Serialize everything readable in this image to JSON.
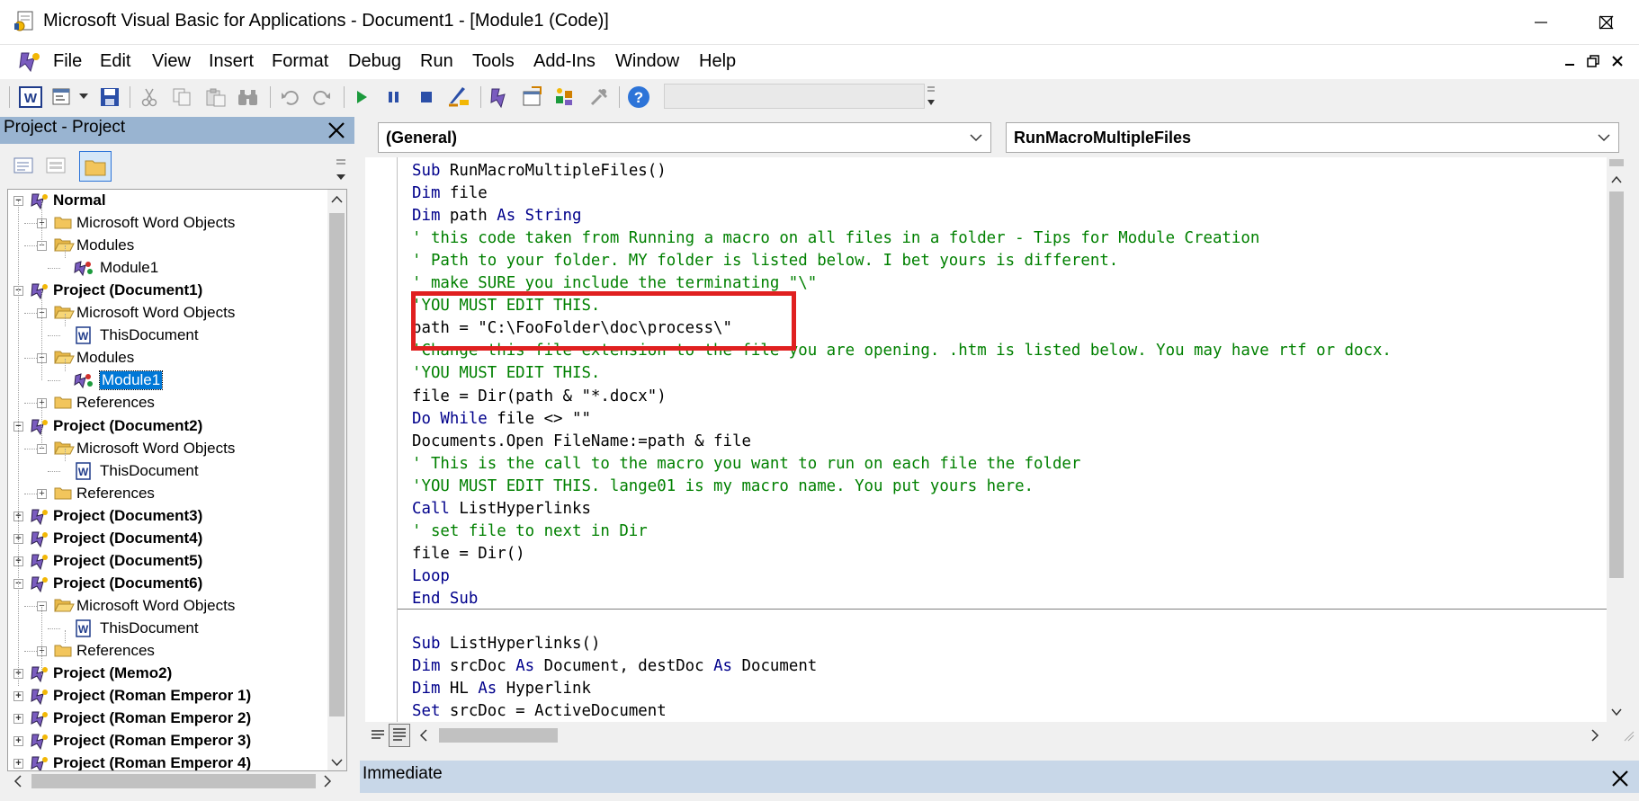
{
  "window": {
    "title": "Microsoft Visual Basic for Applications - Document1 - [Module1 (Code)]",
    "controls": {
      "minimize": "—",
      "maximize": "☐",
      "close": "✕"
    }
  },
  "menu": [
    "File",
    "Edit",
    "View",
    "Insert",
    "Format",
    "Debug",
    "Run",
    "Tools",
    "Add-Ins",
    "Window",
    "Help"
  ],
  "toolbar": {
    "icons": [
      "word-icon",
      "insert-userform-icon",
      "save-icon",
      "cut-icon",
      "copy-icon",
      "paste-icon",
      "find-icon",
      "undo-icon",
      "redo-icon",
      "run-icon",
      "break-icon",
      "reset-icon",
      "design-mode-icon",
      "project-explorer-icon",
      "properties-icon",
      "object-browser-icon",
      "toolbox-icon",
      "help-icon"
    ]
  },
  "project_panel": {
    "title": "Project - Project",
    "tree": [
      {
        "label": "Normal",
        "level": 0,
        "bold": true,
        "expander": "−",
        "icon": "vba-project-icon"
      },
      {
        "label": "Microsoft Word Objects",
        "level": 1,
        "bold": false,
        "expander": "+",
        "icon": "folder-icon"
      },
      {
        "label": "Modules",
        "level": 1,
        "bold": false,
        "expander": "−",
        "icon": "folder-open-icon"
      },
      {
        "label": "Module1",
        "level": 2,
        "bold": false,
        "expander": "",
        "icon": "module-icon"
      },
      {
        "label": "Project (Document1)",
        "level": 0,
        "bold": true,
        "expander": "−",
        "icon": "vba-project-icon"
      },
      {
        "label": "Microsoft Word Objects",
        "level": 1,
        "bold": false,
        "expander": "−",
        "icon": "folder-open-icon"
      },
      {
        "label": "ThisDocument",
        "level": 2,
        "bold": false,
        "expander": "",
        "icon": "word-doc-icon"
      },
      {
        "label": "Modules",
        "level": 1,
        "bold": false,
        "expander": "−",
        "icon": "folder-open-icon"
      },
      {
        "label": "Module1",
        "level": 2,
        "bold": false,
        "expander": "",
        "icon": "module-icon",
        "selected": true
      },
      {
        "label": "References",
        "level": 1,
        "bold": false,
        "expander": "+",
        "icon": "folder-icon"
      },
      {
        "label": "Project (Document2)",
        "level": 0,
        "bold": true,
        "expander": "−",
        "icon": "vba-project-icon"
      },
      {
        "label": "Microsoft Word Objects",
        "level": 1,
        "bold": false,
        "expander": "−",
        "icon": "folder-open-icon"
      },
      {
        "label": "ThisDocument",
        "level": 2,
        "bold": false,
        "expander": "",
        "icon": "word-doc-icon"
      },
      {
        "label": "References",
        "level": 1,
        "bold": false,
        "expander": "+",
        "icon": "folder-icon"
      },
      {
        "label": "Project (Document3)",
        "level": 0,
        "bold": true,
        "expander": "+",
        "icon": "vba-project-icon"
      },
      {
        "label": "Project (Document4)",
        "level": 0,
        "bold": true,
        "expander": "+",
        "icon": "vba-project-icon"
      },
      {
        "label": "Project (Document5)",
        "level": 0,
        "bold": true,
        "expander": "+",
        "icon": "vba-project-icon"
      },
      {
        "label": "Project (Document6)",
        "level": 0,
        "bold": true,
        "expander": "−",
        "icon": "vba-project-icon"
      },
      {
        "label": "Microsoft Word Objects",
        "level": 1,
        "bold": false,
        "expander": "−",
        "icon": "folder-open-icon"
      },
      {
        "label": "ThisDocument",
        "level": 2,
        "bold": false,
        "expander": "",
        "icon": "word-doc-icon"
      },
      {
        "label": "References",
        "level": 1,
        "bold": false,
        "expander": "+",
        "icon": "folder-icon"
      },
      {
        "label": "Project (Memo2)",
        "level": 0,
        "bold": true,
        "expander": "+",
        "icon": "vba-project-icon"
      },
      {
        "label": "Project (Roman Emperor 1)",
        "level": 0,
        "bold": true,
        "expander": "+",
        "icon": "vba-project-icon"
      },
      {
        "label": "Project (Roman Emperor 2)",
        "level": 0,
        "bold": true,
        "expander": "+",
        "icon": "vba-project-icon"
      },
      {
        "label": "Project (Roman Emperor 3)",
        "level": 0,
        "bold": true,
        "expander": "+",
        "icon": "vba-project-icon"
      },
      {
        "label": "Project (Roman Emperor 4)",
        "level": 0,
        "bold": true,
        "expander": "+",
        "icon": "vba-project-icon"
      }
    ]
  },
  "code_window": {
    "object_combo": "(General)",
    "procedure_combo": "RunMacroMultipleFiles",
    "lines": [
      [
        {
          "t": "kw",
          "s": "Sub"
        },
        {
          "t": "tx",
          "s": " RunMacroMultipleFiles()"
        }
      ],
      [
        {
          "t": "kw",
          "s": "Dim"
        },
        {
          "t": "tx",
          "s": " file"
        }
      ],
      [
        {
          "t": "kw",
          "s": "Dim"
        },
        {
          "t": "tx",
          "s": " path "
        },
        {
          "t": "kw",
          "s": "As String"
        }
      ],
      [
        {
          "t": "cm",
          "s": "' this code taken from Running a macro on all files in a folder - Tips for Module Creation"
        }
      ],
      [
        {
          "t": "cm",
          "s": "' Path to your folder. MY folder is listed below. I bet yours is different."
        }
      ],
      [
        {
          "t": "cm",
          "s": "' make SURE you include the terminating \"\\\""
        }
      ],
      [
        {
          "t": "cm",
          "s": "'YOU MUST EDIT THIS."
        }
      ],
      [
        {
          "t": "tx",
          "s": "path = \"C:\\FooFolder\\doc\\process\\\""
        }
      ],
      [
        {
          "t": "cm",
          "s": "'Change this file extension to the file you are opening. .htm is listed below. You may have rtf or docx."
        }
      ],
      [
        {
          "t": "cm",
          "s": "'YOU MUST EDIT THIS."
        }
      ],
      [
        {
          "t": "tx",
          "s": "file = Dir(path & \"*.docx\")"
        }
      ],
      [
        {
          "t": "kw",
          "s": "Do While"
        },
        {
          "t": "tx",
          "s": " file <> \"\""
        }
      ],
      [
        {
          "t": "tx",
          "s": "Documents.Open FileName:=path & file"
        }
      ],
      [
        {
          "t": "cm",
          "s": "' This is the call to the macro you want to run on each file the folder"
        }
      ],
      [
        {
          "t": "cm",
          "s": "'YOU MUST EDIT THIS. lange01 is my macro name. You put yours here."
        }
      ],
      [
        {
          "t": "kw",
          "s": "Call"
        },
        {
          "t": "tx",
          "s": " ListHyperlinks"
        }
      ],
      [
        {
          "t": "cm",
          "s": "' set file to next in Dir"
        }
      ],
      [
        {
          "t": "tx",
          "s": "file = Dir()"
        }
      ],
      [
        {
          "t": "kw",
          "s": "Loop"
        }
      ],
      [
        {
          "t": "kw",
          "s": "End Sub"
        }
      ],
      [],
      [
        {
          "t": "kw",
          "s": "Sub"
        },
        {
          "t": "tx",
          "s": " ListHyperlinks()"
        }
      ],
      [
        {
          "t": "kw",
          "s": "Dim"
        },
        {
          "t": "tx",
          "s": " srcDoc "
        },
        {
          "t": "kw",
          "s": "As"
        },
        {
          "t": "tx",
          "s": " Document, destDoc "
        },
        {
          "t": "kw",
          "s": "As"
        },
        {
          "t": "tx",
          "s": " Document"
        }
      ],
      [
        {
          "t": "kw",
          "s": "Dim"
        },
        {
          "t": "tx",
          "s": " HL "
        },
        {
          "t": "kw",
          "s": "As"
        },
        {
          "t": "tx",
          "s": " Hyperlink"
        }
      ],
      [
        {
          "t": "kw",
          "s": "Set"
        },
        {
          "t": "tx",
          "s": " srcDoc = ActiveDocument"
        }
      ]
    ]
  },
  "immediate": {
    "title": "Immediate"
  },
  "colors": {
    "keyword": "#00008b",
    "comment": "#008000",
    "highlight_box": "#e02020",
    "panel_title": "#99b4d1",
    "selection": "#0078d7"
  }
}
